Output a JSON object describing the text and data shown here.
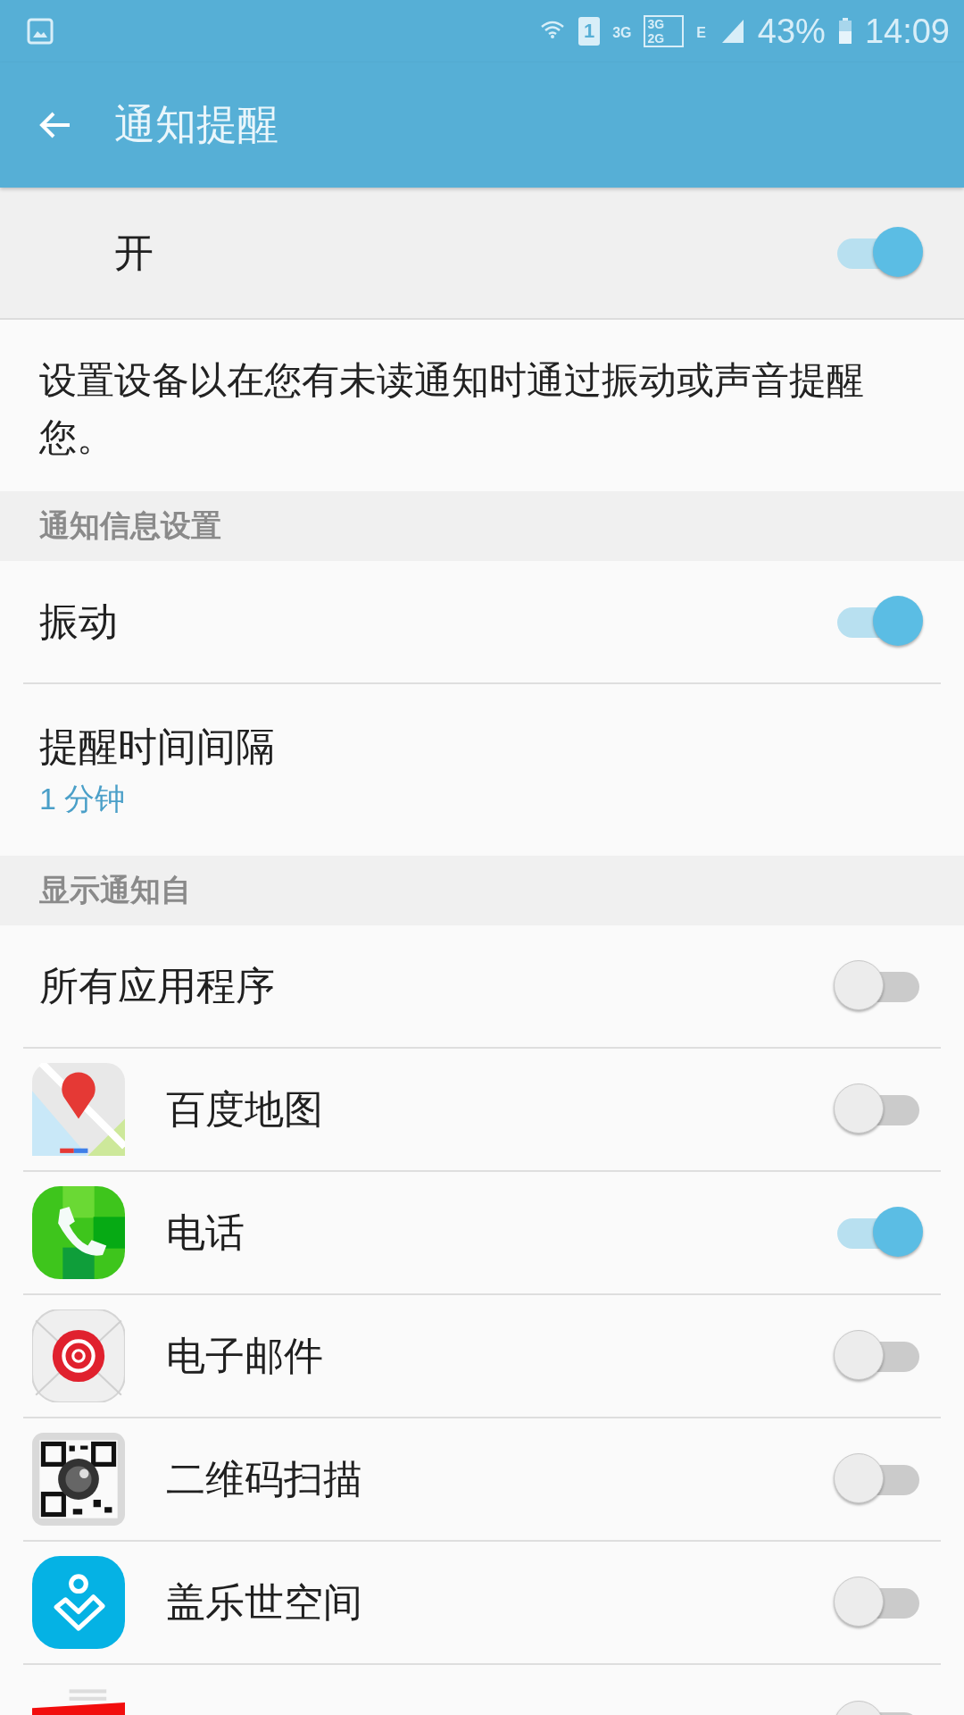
{
  "status_bar": {
    "sim": "1",
    "network_1": "3G",
    "network_2": "3G",
    "network_3": "2G",
    "network_4": "E",
    "battery": "43%",
    "time": "14:09"
  },
  "app_bar": {
    "title": "通知提醒"
  },
  "master": {
    "label": "开",
    "on": true
  },
  "description": "设置设备以在您有未读通知时通过振动或声音提醒您。",
  "sections": [
    {
      "header": "通知信息设置",
      "rows": [
        {
          "kind": "toggle",
          "label": "振动",
          "on": true
        },
        {
          "kind": "value",
          "label": "提醒时间间隔",
          "value": "1 分钟"
        }
      ]
    },
    {
      "header": "显示通知自",
      "rows": [
        {
          "kind": "toggle",
          "label": "所有应用程序",
          "on": false
        },
        {
          "kind": "app",
          "label": "百度地图",
          "on": false
        },
        {
          "kind": "app",
          "label": "电话",
          "on": true
        },
        {
          "kind": "app",
          "label": "电子邮件",
          "on": false
        },
        {
          "kind": "app",
          "label": "二维码扫描",
          "on": false
        },
        {
          "kind": "app",
          "label": "盖乐世空间",
          "on": false
        },
        {
          "kind": "app",
          "on": false
        }
      ]
    }
  ]
}
